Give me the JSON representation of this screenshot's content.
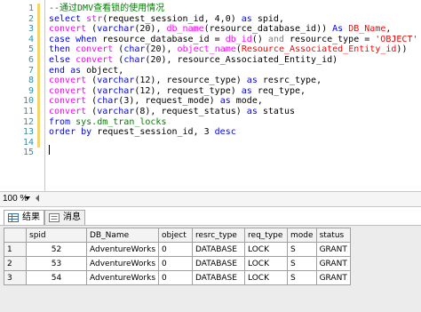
{
  "editor": {
    "line_numbers": [
      "1",
      "2",
      "3",
      "4",
      "5",
      "6",
      "7",
      "8",
      "9",
      "10",
      "11",
      "12",
      "13",
      "14",
      "15"
    ],
    "lines": [
      [
        {
          "t": "--通过DMV查看锁的使用情况",
          "c": "cm"
        }
      ],
      [
        {
          "t": "select ",
          "c": "kw"
        },
        {
          "t": "str",
          "c": "fn"
        },
        {
          "t": "(request_session_id, 4,0) ",
          "c": ""
        },
        {
          "t": "as",
          "c": "kw"
        },
        {
          "t": " spid,",
          "c": ""
        }
      ],
      [
        {
          "t": "convert",
          "c": "fn"
        },
        {
          "t": " (",
          "c": ""
        },
        {
          "t": "varchar",
          "c": "kw"
        },
        {
          "t": "(20), ",
          "c": ""
        },
        {
          "t": "db_name",
          "c": "fn"
        },
        {
          "t": "(resource_database_id)) ",
          "c": ""
        },
        {
          "t": "As",
          "c": "kw"
        },
        {
          "t": " ",
          "c": ""
        },
        {
          "t": "DB_Name",
          "c": "str"
        },
        {
          "t": ",",
          "c": ""
        }
      ],
      [
        {
          "t": "case when",
          "c": "kw"
        },
        {
          "t": " resource_database_id = ",
          "c": ""
        },
        {
          "t": "db_id",
          "c": "fn"
        },
        {
          "t": "() ",
          "c": ""
        },
        {
          "t": "and",
          "c": "gr"
        },
        {
          "t": " resource_type = ",
          "c": ""
        },
        {
          "t": "'OBJECT'",
          "c": "str"
        }
      ],
      [
        {
          "t": "then",
          "c": "kw"
        },
        {
          "t": " ",
          "c": ""
        },
        {
          "t": "convert",
          "c": "fn"
        },
        {
          "t": " (",
          "c": ""
        },
        {
          "t": "char",
          "c": "kw"
        },
        {
          "t": "(20), ",
          "c": ""
        },
        {
          "t": "object_name",
          "c": "fn"
        },
        {
          "t": "(",
          "c": ""
        },
        {
          "t": "Resource_Associated_Entity_id",
          "c": "str"
        },
        {
          "t": "))",
          "c": ""
        }
      ],
      [
        {
          "t": "else",
          "c": "kw"
        },
        {
          "t": " ",
          "c": ""
        },
        {
          "t": "convert",
          "c": "fn"
        },
        {
          "t": " (",
          "c": ""
        },
        {
          "t": "char",
          "c": "kw"
        },
        {
          "t": "(20), resource_Associated_Entity_id)",
          "c": ""
        }
      ],
      [
        {
          "t": "end as",
          "c": "kw"
        },
        {
          "t": " object,",
          "c": ""
        }
      ],
      [
        {
          "t": "convert",
          "c": "fn"
        },
        {
          "t": " (",
          "c": ""
        },
        {
          "t": "varchar",
          "c": "kw"
        },
        {
          "t": "(12), resource_type) ",
          "c": ""
        },
        {
          "t": "as",
          "c": "kw"
        },
        {
          "t": " resrc_type,",
          "c": ""
        }
      ],
      [
        {
          "t": "convert",
          "c": "fn"
        },
        {
          "t": " (",
          "c": ""
        },
        {
          "t": "varchar",
          "c": "kw"
        },
        {
          "t": "(12), request_type) ",
          "c": ""
        },
        {
          "t": "as",
          "c": "kw"
        },
        {
          "t": " req_type,",
          "c": ""
        }
      ],
      [
        {
          "t": "convert",
          "c": "fn"
        },
        {
          "t": " (",
          "c": ""
        },
        {
          "t": "char",
          "c": "kw"
        },
        {
          "t": "(3), request_mode) ",
          "c": ""
        },
        {
          "t": "as",
          "c": "kw"
        },
        {
          "t": " mode,",
          "c": ""
        }
      ],
      [
        {
          "t": "convert",
          "c": "fn"
        },
        {
          "t": " (",
          "c": ""
        },
        {
          "t": "varchar",
          "c": "kw"
        },
        {
          "t": "(8), request_status) ",
          "c": ""
        },
        {
          "t": "as",
          "c": "kw"
        },
        {
          "t": " status",
          "c": ""
        }
      ],
      [
        {
          "t": "from",
          "c": "kw"
        },
        {
          "t": " ",
          "c": ""
        },
        {
          "t": "sys.dm_tran_locks",
          "c": "sys"
        }
      ],
      [
        {
          "t": "order by",
          "c": "kw"
        },
        {
          "t": " request_session_id, 3 ",
          "c": ""
        },
        {
          "t": "desc",
          "c": "kw"
        }
      ],
      [],
      []
    ]
  },
  "zoom": {
    "value": "100 %"
  },
  "tabs": [
    {
      "label": "结果",
      "icon": "grid-icon",
      "active": true
    },
    {
      "label": "消息",
      "icon": "message-icon",
      "active": false
    }
  ],
  "results": {
    "columns": [
      "spid",
      "DB_Name",
      "object",
      "resrc_type",
      "req_type",
      "mode",
      "status"
    ],
    "rows": [
      [
        "52",
        "AdventureWorks",
        "0",
        "DATABASE",
        "LOCK",
        "S",
        "GRANT"
      ],
      [
        "53",
        "AdventureWorks",
        "0",
        "DATABASE",
        "LOCK",
        "S",
        "GRANT"
      ],
      [
        "54",
        "AdventureWorks",
        "0",
        "DATABASE",
        "LOCK",
        "S",
        "GRANT"
      ]
    ],
    "row_numbers": [
      "1",
      "2",
      "3"
    ]
  },
  "colors": {
    "keyword": "#0000ff",
    "function": "#ff00ff",
    "string": "#ff0000",
    "comment": "#008000",
    "line_number": "#2b91af"
  }
}
